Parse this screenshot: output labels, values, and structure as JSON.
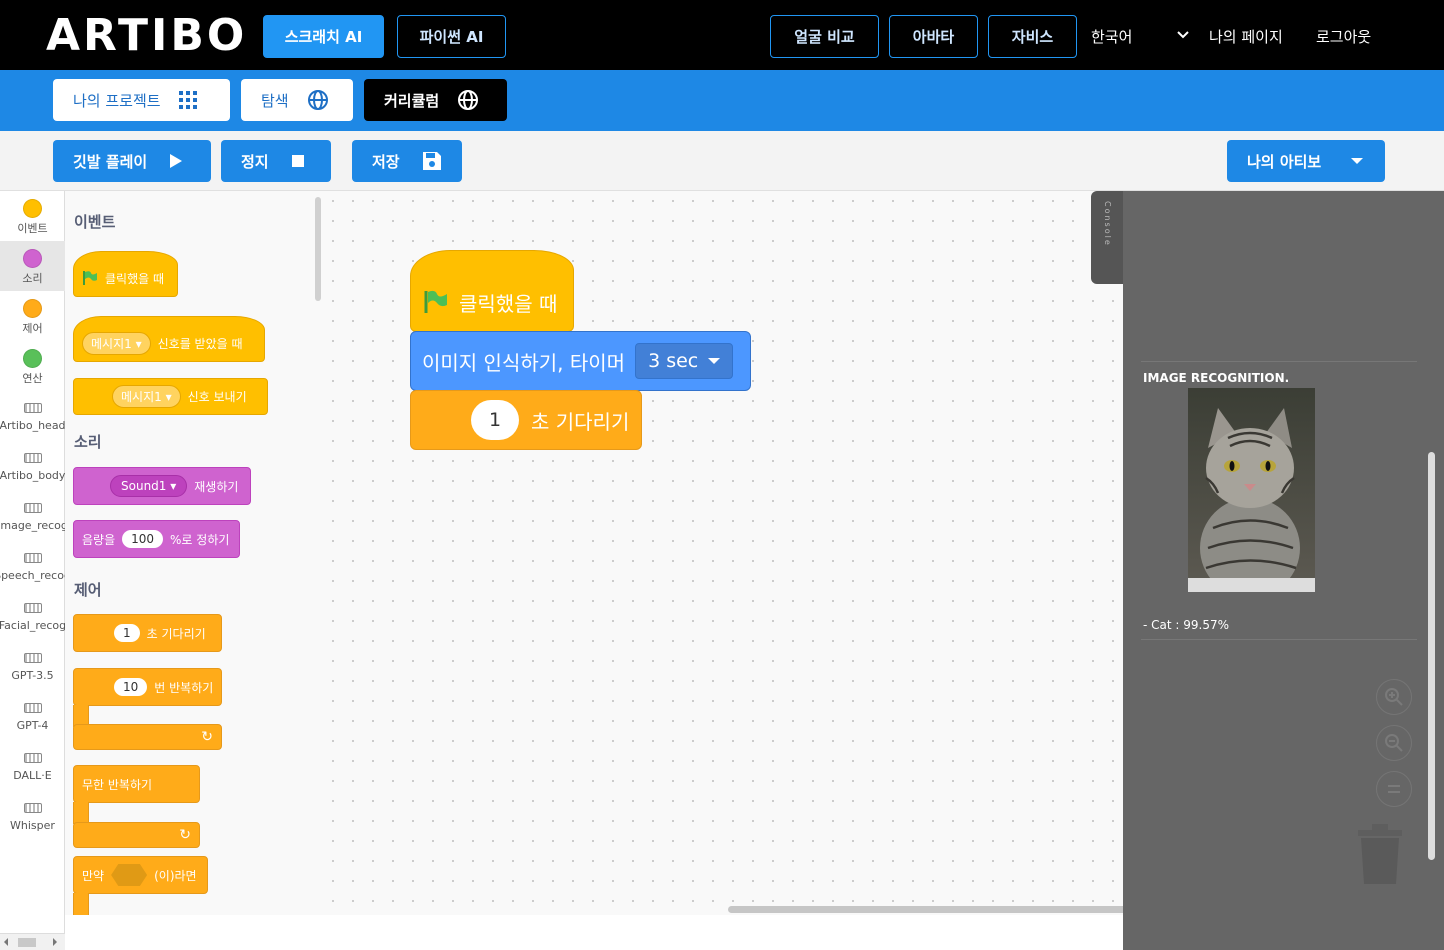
{
  "app": {
    "logo": "ARTIBO"
  },
  "topnav": {
    "scratch_ai": "스크래치 AI",
    "python_ai": "파이썬 AI",
    "face_compare": "얼굴 비교",
    "avatar": "아바타",
    "jarvis": "자비스",
    "language": "한국어",
    "my_page": "나의 페이지",
    "logout": "로그아웃"
  },
  "subnav": {
    "my_project": "나의 프로젝트",
    "explore": "탐색",
    "curriculum": "커리큘럼"
  },
  "toolbar": {
    "play": "깃발 플레이",
    "stop": "정지",
    "save": "저장",
    "my_artibo": "나의 아티보"
  },
  "categories": [
    {
      "label": "이벤트",
      "color": "#ffbf00"
    },
    {
      "label": "소리",
      "color": "#cf63cf"
    },
    {
      "label": "제어",
      "color": "#ffab19"
    },
    {
      "label": "연산",
      "color": "#59c059"
    },
    {
      "label": "Artibo_head"
    },
    {
      "label": "Artibo_body"
    },
    {
      "label": "Image_recog"
    },
    {
      "label": "Speech_recog"
    },
    {
      "label": "Facial_recog"
    },
    {
      "label": "GPT-3.5"
    },
    {
      "label": "GPT-4"
    },
    {
      "label": "DALL·E"
    },
    {
      "label": "Whisper"
    }
  ],
  "palette": {
    "events_title": "이벤트",
    "when_clicked": "클릭했을 때",
    "msg1": "메시지1",
    "on_receive": "신호를 받았을 때",
    "msg2": "메시지1",
    "broadcast": "신호 보내기",
    "sound_title": "소리",
    "sound1": "Sound1",
    "play_sound": "재생하기",
    "volume_pre": "음량을",
    "volume_val": "100",
    "volume_post": "%로 정하기",
    "control_title": "제어",
    "wait_val": "1",
    "wait_label": "초 기다리기",
    "repeat_val": "10",
    "repeat_label": "번 반복하기",
    "forever": "무한 반복하기",
    "if_pre": "만약",
    "if_post": "(이)라면"
  },
  "workspace": {
    "hat_label": "클릭했을 때",
    "recognize_label": "이미지 인식하기, 타이머",
    "timer_value": "3 sec",
    "wait_value": "1",
    "wait_label": "초 기다리기"
  },
  "stage": {
    "console_label": "Console",
    "title": "IMAGE RECOGNITION.",
    "result": "- Cat : 99.57%"
  }
}
